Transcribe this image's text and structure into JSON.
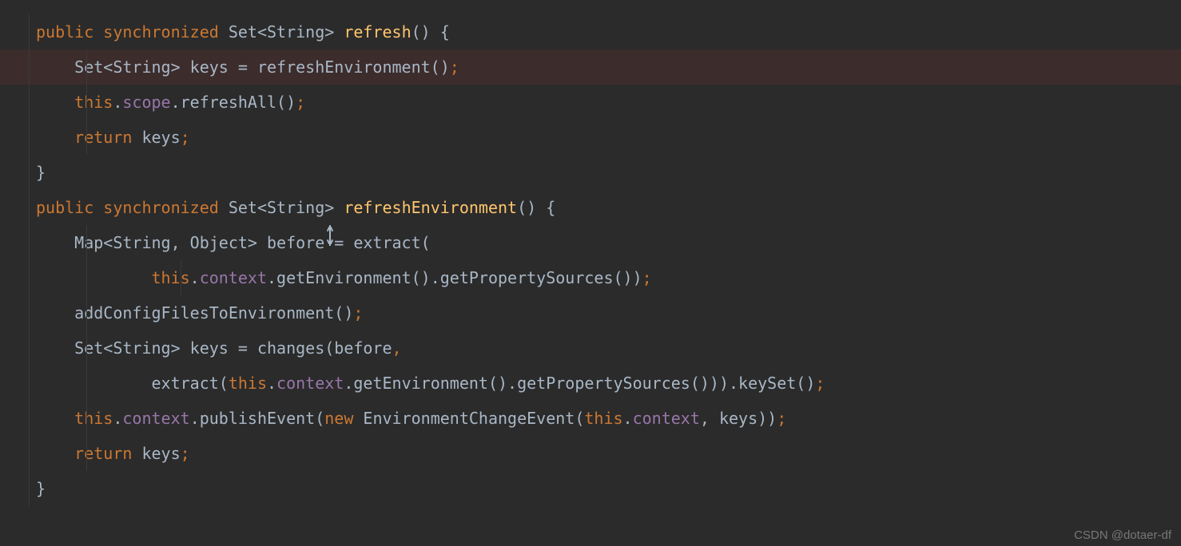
{
  "code": {
    "line1": {
      "kw1": "public",
      "kw2": "synchronized",
      "type": "Set<String>",
      "method": "refresh",
      "after": "() {"
    },
    "line2": {
      "pre": "    Set<String> keys = refreshEnvironment()",
      "semi": ";"
    },
    "line3": {
      "thiskw": "    this",
      "dot1": ".",
      "scope": "scope",
      "dot2": ".",
      "call": "refreshAll()",
      "semi": ";"
    },
    "line4": {
      "ret": "    return",
      "rest": " keys",
      "semi": ";"
    },
    "line5": {
      "brace": "}"
    },
    "line6": {
      "empty": ""
    },
    "line7": {
      "kw1": "public",
      "kw2": "synchronized",
      "type": "Set<String>",
      "method": "refreshEnvironment",
      "after": "() {"
    },
    "line8": {
      "text": "    Map<String, Object> before = extract("
    },
    "line9": {
      "pad": "            ",
      "thiskw": "this",
      "dot1": ".",
      "ctx": "context",
      "rest": ".getEnvironment().getPropertySources())",
      "semi": ";"
    },
    "line10": {
      "text": "    addConfigFilesToEnvironment()",
      "semi": ";"
    },
    "line11": {
      "text": "    Set<String> keys = changes(before",
      "comma": ","
    },
    "line12": {
      "pad": "            extract(",
      "thiskw": "this",
      "dot1": ".",
      "ctx": "context",
      "rest": ".getEnvironment().getPropertySources())).keySet()",
      "semi": ";"
    },
    "line13": {
      "pad": "    ",
      "thiskw": "this",
      "dot1": ".",
      "ctx": "context",
      "mid": ".publishEvent(",
      "newkw": "new",
      "sp": " EnvironmentChangeEvent(",
      "thiskw2": "this",
      "dot2": ".",
      "ctx2": "context",
      "rest": ", keys))",
      "semi": ";"
    },
    "line14": {
      "ret": "    return",
      "rest": " keys",
      "semi": ";"
    },
    "line15": {
      "brace": "}"
    }
  },
  "watermark": "CSDN @dotaer-df"
}
